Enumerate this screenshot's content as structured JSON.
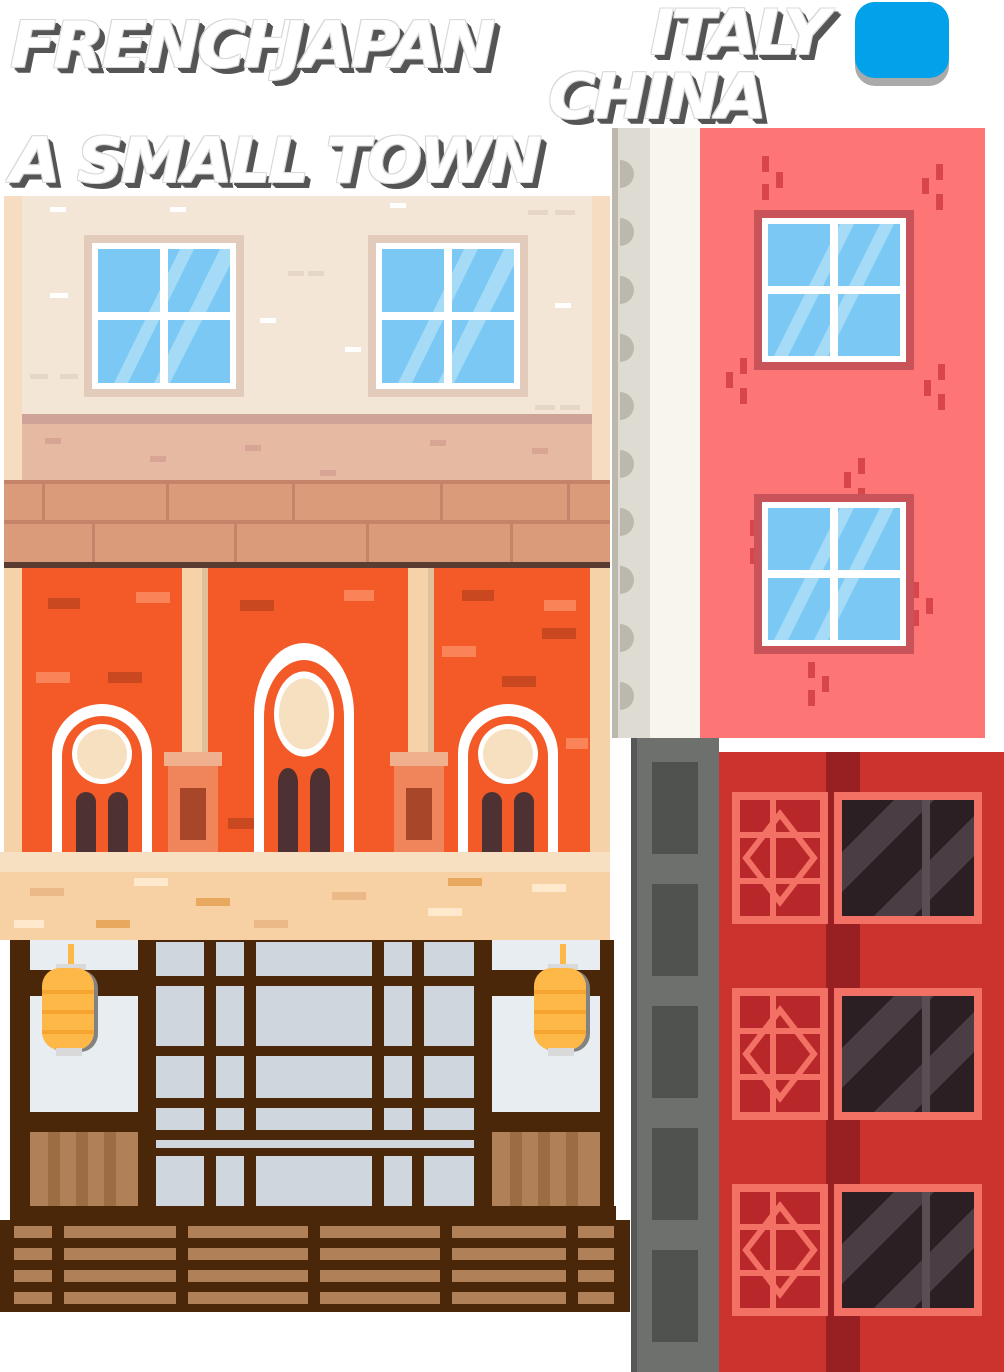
{
  "labels": {
    "french": "FRENCH",
    "japan": "JAPAN",
    "italy": "ITALY",
    "china": "CHINA",
    "subtitle": "A SMALL TOWN"
  },
  "colors": {
    "button_blue": "#02a2ea",
    "italy_wall": "#fe7575",
    "french_ground_wall": "#f35a27",
    "japan_wood": "#4a2708",
    "japan_lantern": "#fdb848",
    "china_red": "#ca332e",
    "china_gray_column": "#6d706d",
    "glass_blue": "#7ac8f3"
  },
  "icons": {
    "button": "blue-rounded-button",
    "lantern": "paper-lantern-icon",
    "window": "window-icon"
  }
}
